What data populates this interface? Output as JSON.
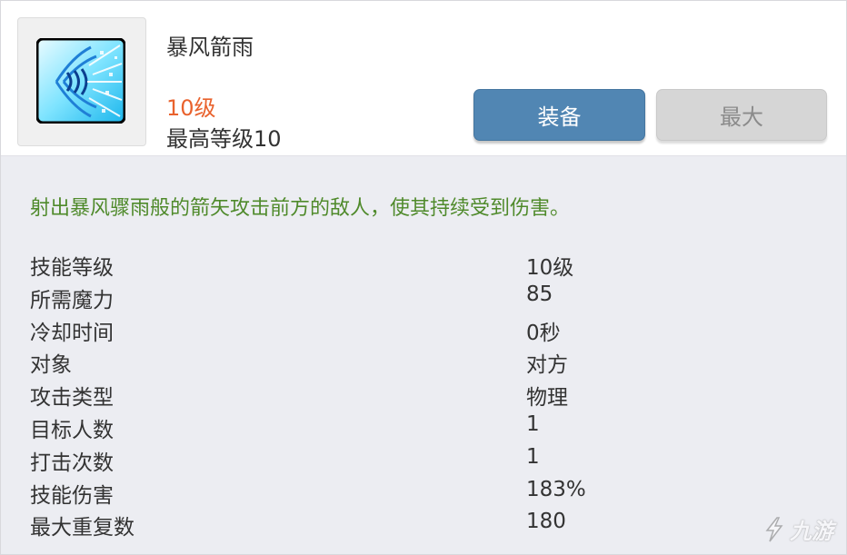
{
  "skill": {
    "name": "暴风箭雨",
    "level": "10级",
    "max_level": "最高等级10",
    "icon": "storm-arrow-skill-icon"
  },
  "buttons": {
    "equip": "装备",
    "max": "最大"
  },
  "description": "射出暴风骤雨般的箭矢攻击前方的敌人，使其持续受到伤害。",
  "stats": [
    {
      "label": "技能等级",
      "value": "10级"
    },
    {
      "label": "所需魔力",
      "value": "85"
    },
    {
      "label": "冷却时间",
      "value": "0秒"
    },
    {
      "label": "对象",
      "value": "对方"
    },
    {
      "label": "攻击类型",
      "value": "物理"
    },
    {
      "label": "目标人数",
      "value": "1"
    },
    {
      "label": "打击次数",
      "value": "1"
    },
    {
      "label": "技能伤害",
      "value": "183%"
    },
    {
      "label": "最大重复数",
      "value": "180"
    }
  ],
  "watermark": "九游",
  "colors": {
    "level_text": "#e9622d",
    "description_text": "#4f8a2b",
    "equip_button": "#5186b3",
    "max_button": "#d6d6d6",
    "body_background": "#ecedf2"
  }
}
